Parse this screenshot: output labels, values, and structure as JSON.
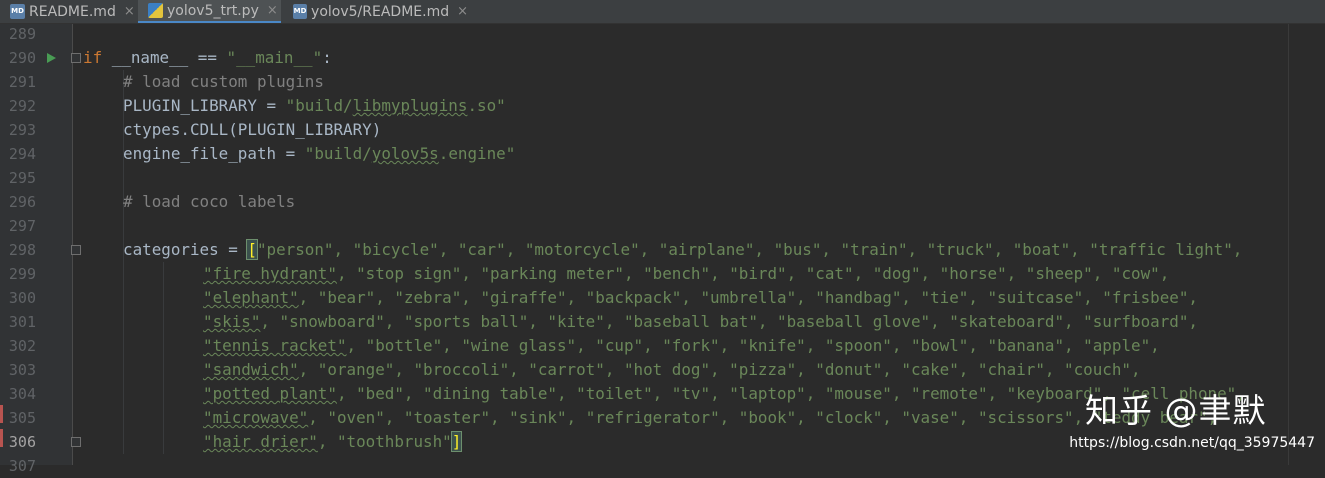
{
  "tabs": [
    {
      "label": "README.md",
      "icon": "markdown-file-icon",
      "active": false
    },
    {
      "label": "yolov5_trt.py",
      "icon": "python-file-icon",
      "active": true
    },
    {
      "label": "yolov5/README.md",
      "icon": "markdown-file-icon",
      "active": false
    }
  ],
  "tab_close_glyph": "×",
  "line_numbers": [
    "289",
    "290",
    "291",
    "292",
    "293",
    "294",
    "295",
    "296",
    "297",
    "298",
    "299",
    "300",
    "301",
    "302",
    "303",
    "304",
    "305",
    "306",
    "307"
  ],
  "current_line": "306",
  "code": {
    "l290": {
      "kw": "if",
      "rest": " __name__ == ",
      "str": "\"__main__\"",
      "end": ":"
    },
    "l291": "# load custom plugins",
    "l292": {
      "a": "PLUGIN_LIBRARY = ",
      "s1": "\"build/",
      "s2": "libmyplugins",
      "s3": ".so\""
    },
    "l293": "ctypes.CDLL(PLUGIN_LIBRARY)",
    "l294": {
      "a": "engine_file_path = ",
      "s1": "\"build/",
      "s2": "yolov5s",
      "s3": ".engine\""
    },
    "l296": "# load coco labels",
    "l298": {
      "a": "categories = ",
      "open": "[",
      "s": "\"person\", \"bicycle\", \"car\", \"motorcycle\", \"airplane\", \"bus\", \"train\", \"truck\", \"boat\", \"traffic light\","
    },
    "l299": {
      "w": "\"fire hydrant\"",
      "s": ", \"stop sign\", \"parking meter\", \"bench\", \"bird\", \"cat\", \"dog\", \"horse\", \"sheep\", \"cow\","
    },
    "l300": {
      "w": "\"elephant\"",
      "s": ", \"bear\", \"zebra\", \"giraffe\", \"backpack\", \"umbrella\", \"handbag\", \"tie\", \"suitcase\", \"frisbee\","
    },
    "l301": {
      "w": "\"skis\"",
      "s": ", \"snowboard\", \"sports ball\", \"kite\", \"baseball bat\", \"baseball glove\", \"skateboard\", \"surfboard\","
    },
    "l302": {
      "w": "\"tennis racket\"",
      "s": ", \"bottle\", \"wine glass\", \"cup\", \"fork\", \"knife\", \"spoon\", \"bowl\", \"banana\", \"apple\","
    },
    "l303": {
      "w": "\"sandwich\"",
      "s": ", \"orange\", \"broccoli\", \"carrot\", \"hot dog\", \"pizza\", \"donut\", \"cake\", \"chair\", \"couch\","
    },
    "l304": {
      "w": "\"potted plant\"",
      "s": ", \"bed\", \"dining table\", \"toilet\", \"tv\", \"laptop\", \"mouse\", \"remote\", \"keyboard\", \"cell phone\","
    },
    "l305": {
      "w": "\"microwave\"",
      "s": ", \"oven\", \"toaster\", \"sink\", \"refrigerator\", \"book\", \"clock\", \"vase\", \"scissors\", \"teddy bear\","
    },
    "l306": {
      "w": "\"hair drier\"",
      "s": ", \"toothbrush\"",
      "close": "]"
    }
  },
  "watermark": {
    "text": "知乎 @聿默",
    "url": "https://blog.csdn.net/qq_35975447"
  }
}
